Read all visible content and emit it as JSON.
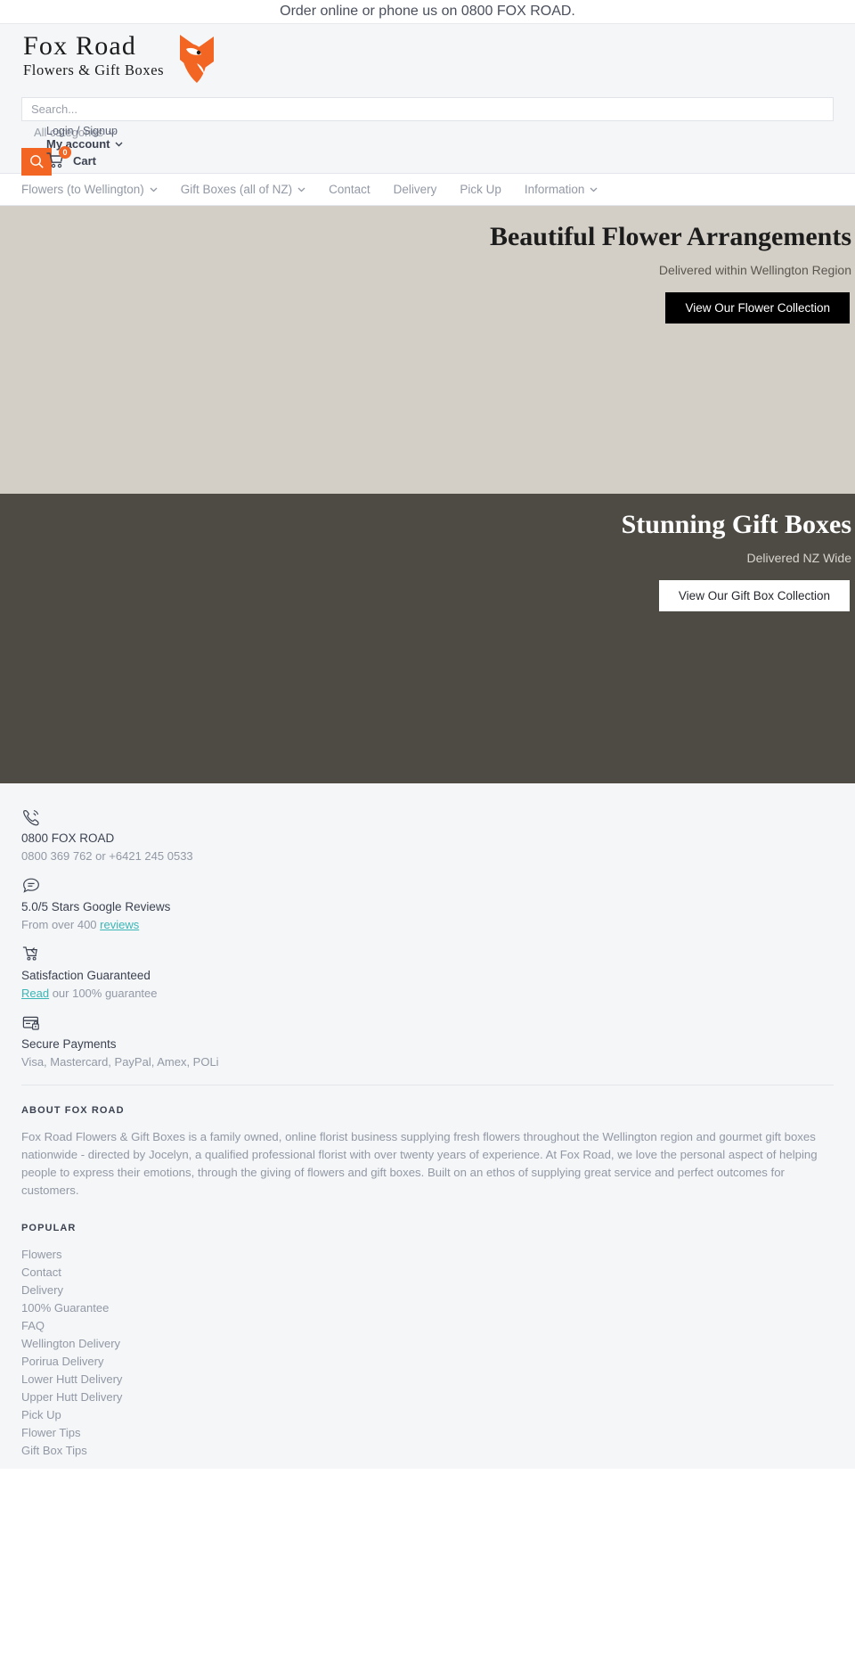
{
  "announcement": {
    "text": "Order online or phone us on 0800 FOX ROAD."
  },
  "header": {
    "logo_line1": "Fox Road",
    "logo_line2": "Flowers & Gift Boxes",
    "logo_icon": "fox-head-icon",
    "search_placeholder": "Search...",
    "search_value": "",
    "search_icon": "search-icon",
    "all_categories": "All categories",
    "login_signup": "Login / Signup",
    "my_account": "My account",
    "cart_label": "Cart",
    "cart_count": "0",
    "chevron": "⌄"
  },
  "nav": {
    "items": [
      {
        "label": "Flowers (to Wellington)",
        "has_caret": true
      },
      {
        "label": "Gift Boxes (all of NZ)",
        "has_caret": true
      },
      {
        "label": "Contact",
        "has_caret": false
      },
      {
        "label": "Delivery",
        "has_caret": false
      },
      {
        "label": "Pick Up",
        "has_caret": false
      },
      {
        "label": "Information",
        "has_caret": true
      }
    ]
  },
  "heroes": [
    {
      "title": "Beautiful Flower Arrangements",
      "subtitle": "Delivered within Wellington Region",
      "button": "View Our Flower Collection",
      "bg_color": "#d4cfc6",
      "button_style": "dark"
    },
    {
      "title": "Stunning Gift Boxes",
      "subtitle": "Delivered NZ Wide",
      "button": "View Our Gift Box Collection",
      "bg_color": "#4e4a44",
      "button_style": "light"
    }
  ],
  "footer": {
    "badges": [
      {
        "icon": "phone-ring-icon",
        "title": "0800 FOX ROAD",
        "sub_prefix": "0800 369 762 or +6421 245 0533",
        "link": "",
        "sub_suffix": ""
      },
      {
        "icon": "chat-bubble-icon",
        "title": "5.0/5 Stars Google Reviews",
        "sub_prefix": "From over 400 ",
        "link": "reviews",
        "sub_suffix": ""
      },
      {
        "icon": "cart-return-icon",
        "title": "Satisfaction Guaranteed",
        "sub_prefix": "",
        "link": "Read",
        "sub_suffix": " our 100% guarantee"
      },
      {
        "icon": "secure-card-icon",
        "title": "Secure Payments",
        "sub_prefix": "Visa, Mastercard, PayPal, Amex, POLi",
        "link": "",
        "sub_suffix": ""
      }
    ],
    "about_heading": "ABOUT FOX ROAD",
    "about_text": "Fox Road Flowers & Gift Boxes is a family owned, online florist business supplying fresh flowers throughout the Wellington region and gourmet gift boxes nationwide - directed by Jocelyn, a qualified professional florist with over twenty years of experience. At Fox Road, we love the personal aspect of helping people to express their emotions, through the giving of flowers and gift boxes. Built on an ethos of supplying great service and perfect outcomes for customers.",
    "popular_heading": "POPULAR",
    "popular_links": [
      "Flowers",
      "Contact",
      "Delivery",
      "100% Guarantee",
      "FAQ",
      "Wellington Delivery",
      "Porirua Delivery",
      "Lower Hutt Delivery",
      "Upper Hutt Delivery",
      "Pick Up",
      "Flower Tips",
      "Gift Box Tips"
    ]
  },
  "colors": {
    "accent_orange": "#f26522",
    "link_teal": "#3bb6b6",
    "hero_light_bg": "#d4cfc6",
    "hero_dark_bg": "#4e4a44",
    "page_bg": "#f4f6f8"
  }
}
